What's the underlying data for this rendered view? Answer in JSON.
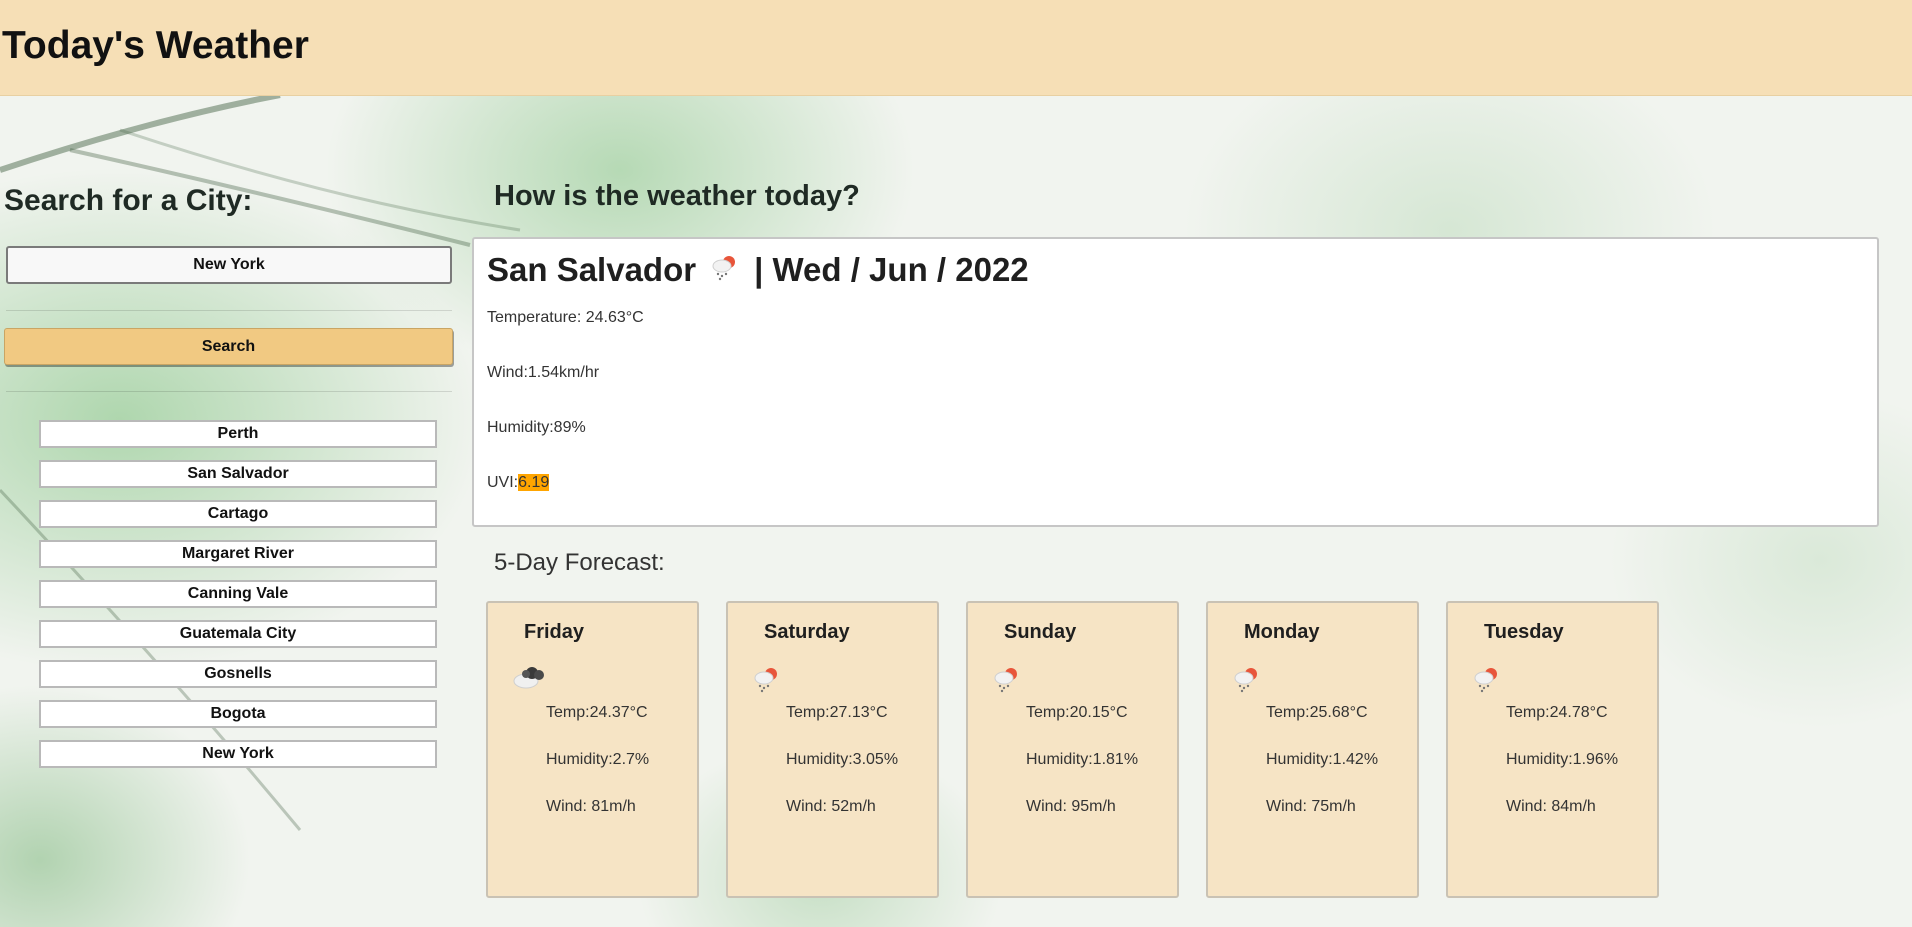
{
  "header": {
    "title": "Today's Weather"
  },
  "sidebar": {
    "search_title": "Search for a City:",
    "search_input_value": "New York",
    "search_button_label": "Search",
    "history": [
      "Perth",
      "San Salvador",
      "Cartago",
      "Margaret River",
      "Canning Vale",
      "Guatemala City",
      "Gosnells",
      "Bogota",
      "New York"
    ]
  },
  "main": {
    "title": "How is the weather today?",
    "current": {
      "city": "San Salvador",
      "icon": "light-rain-icon",
      "date": "| Wed / Jun / 2022",
      "temperature": "Temperature: 24.63°C",
      "wind": "Wind:1.54km/hr",
      "humidity": "Humidity:89%",
      "uvi_label": "UVI:",
      "uvi_value": "6.19",
      "uvi_color": "#ffa500"
    },
    "forecast_title": "5-Day Forecast:",
    "forecast": [
      {
        "day": "Friday",
        "icon": "dark-cloud-icon",
        "temp": "Temp:24.37°C",
        "humidity": "Humidity:2.7%",
        "wind": "Wind: 81m/h"
      },
      {
        "day": "Saturday",
        "icon": "light-rain-icon",
        "temp": "Temp:27.13°C",
        "humidity": "Humidity:3.05%",
        "wind": "Wind: 52m/h"
      },
      {
        "day": "Sunday",
        "icon": "light-rain-icon",
        "temp": "Temp:20.15°C",
        "humidity": "Humidity:1.81%",
        "wind": "Wind: 95m/h"
      },
      {
        "day": "Monday",
        "icon": "light-rain-icon",
        "temp": "Temp:25.68°C",
        "humidity": "Humidity:1.42%",
        "wind": "Wind: 75m/h"
      },
      {
        "day": "Tuesday",
        "icon": "light-rain-icon",
        "temp": "Temp:24.78°C",
        "humidity": "Humidity:1.96%",
        "wind": "Wind: 84m/h"
      }
    ]
  },
  "colors": {
    "header_bg": "#f6dfb6",
    "search_button": "#f1c982",
    "card_bg": "#f6e4c5",
    "uvi_highlight": "#ffa500"
  }
}
